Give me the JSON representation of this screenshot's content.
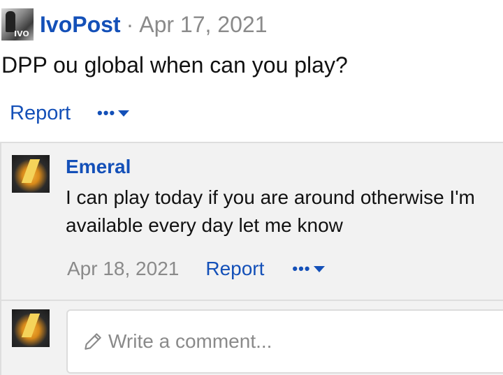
{
  "post": {
    "author": "IvoPost",
    "separator": "·",
    "date": "Apr 17, 2021",
    "body": "DPP ou global when can you play?",
    "avatar_label": "IVO",
    "report_label": "Report",
    "more_label": "•••"
  },
  "reply": {
    "author": "Emeral",
    "body": "I can play today if you are around otherwise I'm available every day let me know",
    "date": "Apr 18, 2021",
    "report_label": "Report",
    "more_label": "•••"
  },
  "comment": {
    "placeholder": "Write a comment..."
  },
  "colors": {
    "link": "#1450b8",
    "muted": "#8a8a8a",
    "reply_bg": "#f2f2f2"
  }
}
